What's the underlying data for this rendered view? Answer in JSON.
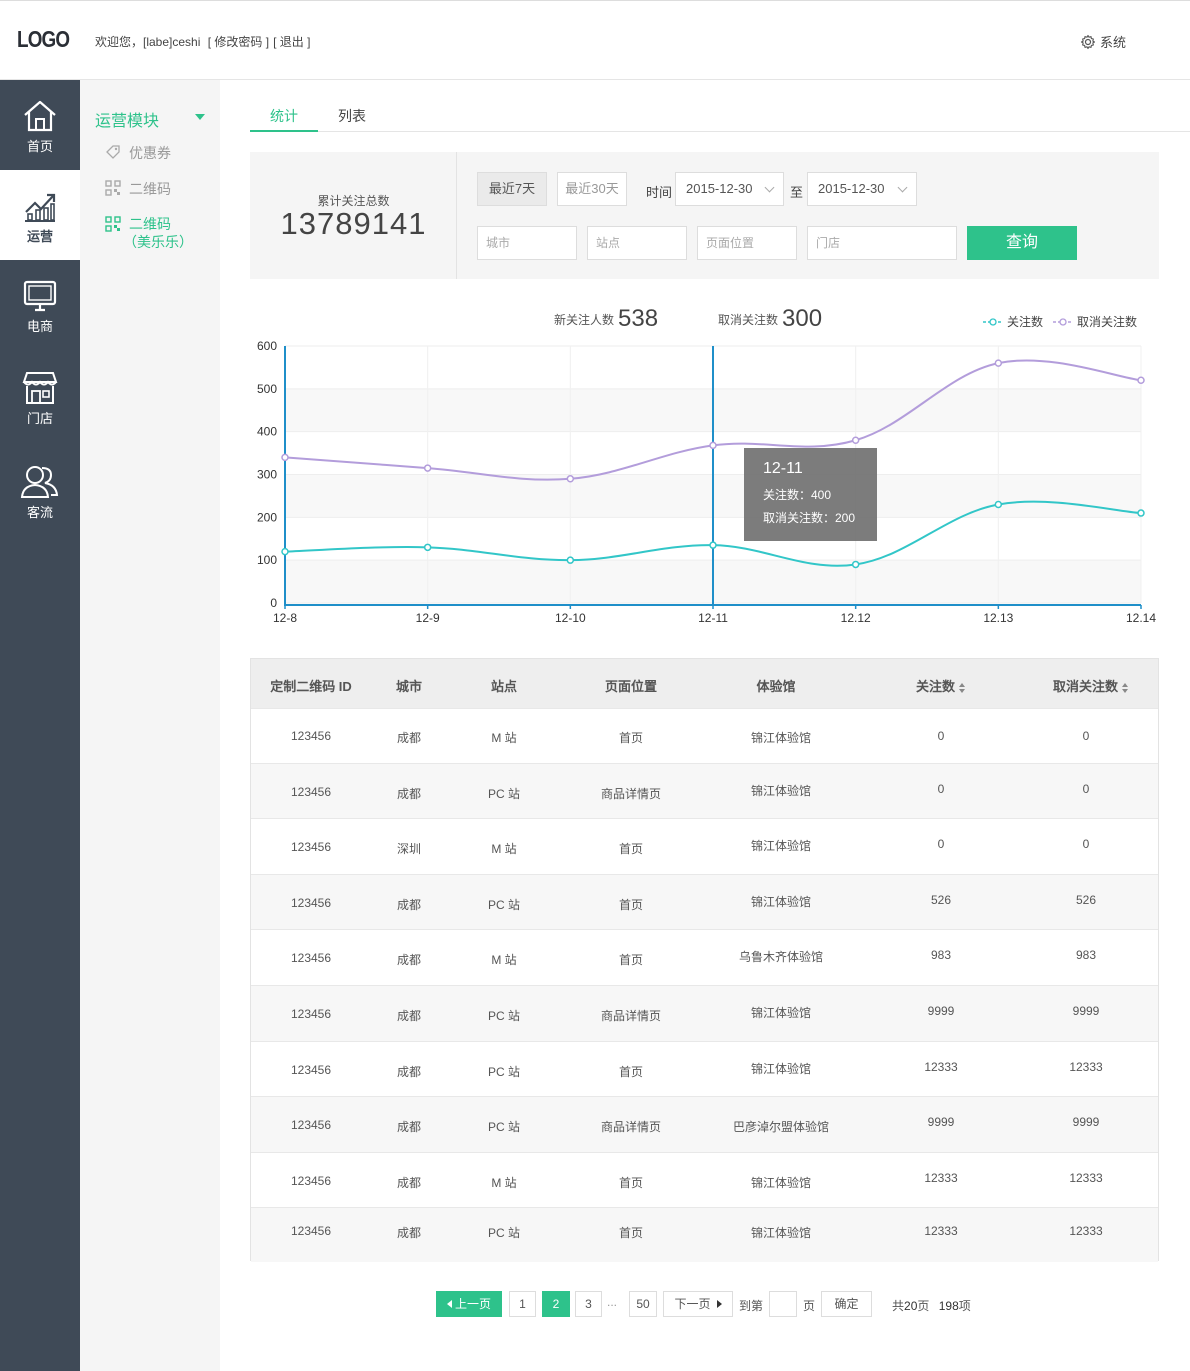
{
  "header": {
    "logo": "LOGO",
    "welcome": "欢迎您，[labe]ceshi",
    "change_password": "[ 修改密码 ]",
    "logout": "[ 退出 ]",
    "system": "系统"
  },
  "leftnav": {
    "items": [
      {
        "label": "首页",
        "icon": "home-icon"
      },
      {
        "label": "运营",
        "icon": "chart-trend-icon"
      },
      {
        "label": "电商",
        "icon": "monitor-icon"
      },
      {
        "label": "门店",
        "icon": "store-icon"
      },
      {
        "label": "客流",
        "icon": "users-icon"
      }
    ],
    "active_index": 1
  },
  "subnav": {
    "title": "运营模块",
    "items": [
      {
        "label": "优惠券",
        "icon": "coupon-icon"
      },
      {
        "label": "二维码",
        "icon": "qrcode-icon"
      },
      {
        "label": "二维码",
        "sub": "（美乐乐）",
        "icon": "qrcode-icon"
      }
    ],
    "active_index": 2
  },
  "tabs": [
    {
      "label": "统计"
    },
    {
      "label": "列表"
    }
  ],
  "filter": {
    "total_label": "累计关注总数",
    "total_value": "13789141",
    "btn_7days": "最近7天",
    "btn_30days": "最近30天",
    "time_label": "时间",
    "date_from": "2015-12-30",
    "to_label": "至",
    "date_to": "2015-12-30",
    "city_placeholder": "城市",
    "site_placeholder": "站点",
    "page_placeholder": "页面位置",
    "store_placeholder": "门店",
    "query_label": "查询"
  },
  "summary": {
    "new_follow_label": "新关注人数",
    "new_follow_value": "538",
    "unfollow_label": "取消关注数",
    "unfollow_value": "300"
  },
  "chart_data": {
    "type": "line",
    "categories": [
      "12-8",
      "12-9",
      "12-10",
      "12-11",
      "12.12",
      "12.13",
      "12.14"
    ],
    "series": [
      {
        "name": "关注数",
        "color": "#32c6c8",
        "values": [
          120,
          130,
          100,
          135,
          90,
          230,
          210
        ]
      },
      {
        "name": "取消关注数",
        "color": "#b39ddb",
        "values": [
          340,
          315,
          290,
          368,
          380,
          560,
          520
        ]
      }
    ],
    "ylim": [
      0,
      600
    ],
    "yticks": [
      0,
      100,
      200,
      300,
      400,
      500,
      600
    ],
    "grid": true,
    "legend": "top-right",
    "highlight_index": 3,
    "tooltip": {
      "title": "12-11",
      "line1": "关注数：400",
      "line2": "取消关注数：200"
    }
  },
  "table": {
    "headers": [
      "定制二维码 ID",
      "城市",
      "站点",
      "页面位置",
      "体验馆",
      "关注数",
      "取消关注数"
    ],
    "rows": [
      [
        "123456",
        "成都",
        "M 站",
        "首页",
        "锦江体验馆",
        "0",
        "0"
      ],
      [
        "123456",
        "成都",
        "PC 站",
        "商品详情页",
        "锦江体验馆",
        "0",
        "0"
      ],
      [
        "123456",
        "深圳",
        "M 站",
        "首页",
        "锦江体验馆",
        "0",
        "0"
      ],
      [
        "123456",
        "成都",
        "PC 站",
        "首页",
        "锦江体验馆",
        "526",
        "526"
      ],
      [
        "123456",
        "成都",
        "M 站",
        "首页",
        "乌鲁木齐体验馆",
        "983",
        "983"
      ],
      [
        "123456",
        "成都",
        "PC 站",
        "商品详情页",
        "锦江体验馆",
        "9999",
        "9999"
      ],
      [
        "123456",
        "成都",
        "PC 站",
        "首页",
        "锦江体验馆",
        "12333",
        "12333"
      ],
      [
        "123456",
        "成都",
        "PC 站",
        "商品详情页",
        "巴彦淖尔盟体验馆",
        "9999",
        "9999"
      ],
      [
        "123456",
        "成都",
        "M 站",
        "首页",
        "锦江体验馆",
        "12333",
        "12333"
      ],
      [
        "123456",
        "成都",
        "PC 站",
        "首页",
        "锦江体验馆",
        "12333",
        "12333"
      ]
    ]
  },
  "pager": {
    "prev": "上一页",
    "pages": [
      "1",
      "2",
      "3"
    ],
    "ellipsis": "...",
    "last": "50",
    "current": "2",
    "next": "下一页",
    "goto_label": "到第",
    "page_unit": "页",
    "confirm": "确定",
    "total_prefix": "共",
    "total_pages": "20",
    "pages_suffix": "页",
    "total_items": "198",
    "items_suffix": "项"
  },
  "colors": {
    "accent": "#2ec28b",
    "sidebar": "#3f4a57"
  }
}
